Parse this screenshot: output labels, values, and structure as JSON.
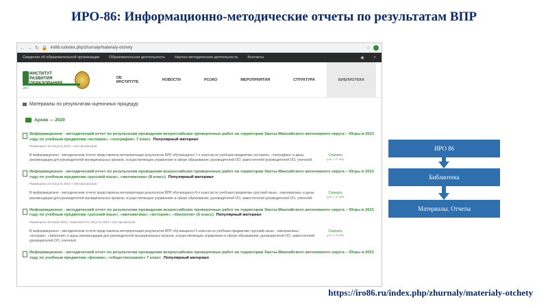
{
  "slide": {
    "title": "ИРО-86: Информационно-методические отчеты по результатам ВПР",
    "link": "https://iro86.ru/index.php/zhurnaly/materialy-otchety"
  },
  "browser": {
    "url": "iro86.ru/index.php/zhurnaly/materialy-otchety"
  },
  "topbar": {
    "links": [
      "Сведения об образовательной организации",
      "Образовательная деятельность",
      "Научно-методическая деятельность",
      "Контакты"
    ]
  },
  "site": {
    "logo_line1": "ИНСТИТУТ РАЗВИТИЯ",
    "logo_line2": "ОБРАЗОВАНИЯ",
    "logo_abbr": "ИРО",
    "menu": [
      "ОБ ИНСТИТУТЕ",
      "НОВОСТИ",
      "РСОКО",
      "МЕРОПРИЯТИЯ",
      "СТРУКТУРА",
      "БИБЛИОТЕКА"
    ]
  },
  "page": {
    "heading": "Материалы по результатам оценочных процедур",
    "archive": "Архив — 2020",
    "popular": "Популярный материал",
    "download": "Скачать",
    "items": [
      {
        "title": "Информационно - методический отчет по результатам проведения всероссийских проверочных работ на территории Ханты-Мансийского автономного округа – Югры в 2021 году по учебным предметам «история», «география» 7 класс",
        "meta": "Размещено 19 Августа 2021 • 146 просмотров",
        "desc": "В информационно - методическом отчете представлена интерпретация результатов ВПР обучающихся 7-х классов по учебным предметам «история», «география» и даны рекомендации для руководителей муниципальных органов, осуществляющих управление в сфере образования, руководителей ОО, заместителей руководителей ОО, учителей.",
        "size": "(pdf, 1.47 MB)"
      },
      {
        "title": "Информационно - методический отчет по результатам проведения всероссийских проверочных работ на территории Ханты-Мансийского автономного округа – Югры в 2021 году по учебным предметам «русский язык», «математика» (8 класс)",
        "meta": "Размещено 23 Августа 2021 • 106 просмотров",
        "desc": "В информационно - методическом отчете представлена интерпретация результатов ВПР обучающихся 8-х классов по учебным предметам «русский язык», «математика» и даны рекомендации для руководителей муниципальных органов, осуществляющих управление в сфере образования, руководителей ОО, заместителей руководителей ОО, учителей.",
        "size": "(pdf, 1.47 MB)"
      },
      {
        "title": "Информационно - методический отчет по результатам проведения всероссийских проверочных работ на территории Ханты-Мансийского автономного округа – Югры в 2021 году по учебным предметам «русский язык», «математика», «история», «биология» (5 класс)",
        "meta": "Размещено 30 Июня 2021 • Изменено 01 Августа 2021 • 211 просмотров",
        "desc": "В информационно - методическом отчете представлена интерпретация результатов ВПР обучающихся 5 классов по учебным предметам «русский язык», «математика», «история», «биология» и даны рекомендации для руководителей муниципальных органов, осуществляющих управление в сфере образования, руководителей ОО, заместителей руководителей ОО, учителей.",
        "size": "(pdf, 2.46 MB)"
      },
      {
        "title": "Информационно - методический отчет по результатам проведения всероссийских проверочных работ на территории Ханты-Мансийского автономного округа – Югры в 2021 году по учебным предметам «физика», «обществознание» 7 класс"
      }
    ]
  },
  "flow": {
    "steps": [
      "ИРО 86",
      "Библиотека",
      "Материалы. Отчеты"
    ]
  }
}
